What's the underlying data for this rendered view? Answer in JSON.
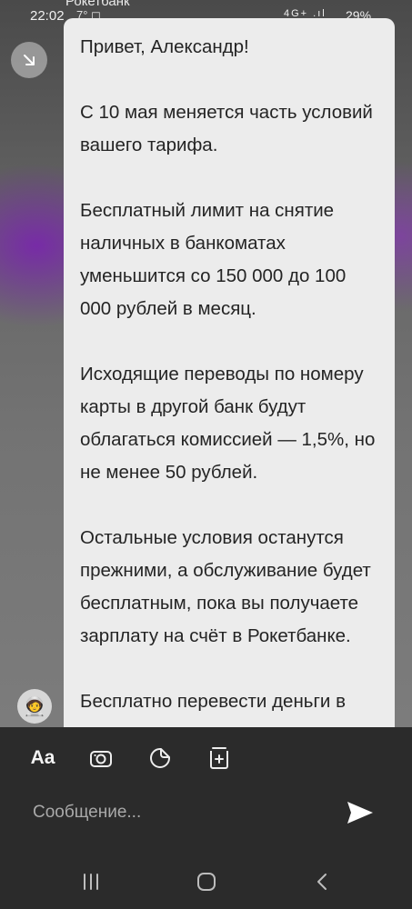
{
  "status_bar": {
    "time": "22:02",
    "extra": "7° ◻",
    "sender": "Рокетбанк",
    "signal": "4G+ .ıl",
    "battery": "29%"
  },
  "message": {
    "text": "Привет, Александр!\n\nС 10 мая меняется часть условий вашего тарифа.\n\nБесплатный лимит на снятие наличных в банкоматах уменьшится со 150 000 до 100 000 рублей в месяц.\n\nИсходящие переводы по номеру карты в другой банк будут облагаться комиссией — 1,5%, но не менее 50 рублей.\n\nОстальные условия останутся прежними, а обслуживание будет бесплатным, пока вы получаете зарплату на счёт в Рокетбанке.\n\nБесплатно перевести деньги в"
  },
  "avatar": {
    "emoji": "🧑‍🚀"
  },
  "compose": {
    "format_label": "Aa",
    "placeholder": "Сообщение..."
  },
  "icons": {
    "back": "collapse-arrow-icon",
    "camera": "camera-icon",
    "sticker": "sticker-icon",
    "gallery": "gallery-add-icon",
    "send": "send-icon",
    "recents": "recents-icon",
    "home": "home-icon",
    "nav_back": "chevron-left-icon"
  },
  "colors": {
    "card": "#ececec",
    "panel": "#2b2b2b",
    "accent_purple": "#7a28aa"
  }
}
